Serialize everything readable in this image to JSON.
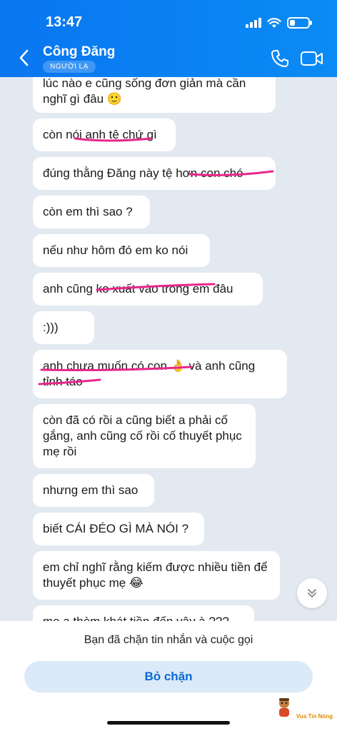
{
  "status_bar": {
    "time": "13:47"
  },
  "header": {
    "contact_name": "Công Đăng",
    "badge": "NGƯỜI LẠ"
  },
  "messages": [
    {
      "text": "lúc nào e cũng sống đơn giản mà cần nghĩ gì đâu 🙂"
    },
    {
      "text": "còn nói anh tệ chứ gì"
    },
    {
      "text": "đúng thằng Đăng này tệ hơn con chó"
    },
    {
      "text": "còn em thì sao ?"
    },
    {
      "text": "nếu như hôm đó em ko nói"
    },
    {
      "text": "anh cũng ko xuất vào trong em đâu"
    },
    {
      "text": ":)))"
    },
    {
      "text": "anh chưa muốn có con 👌 và anh cũng tỉnh táo"
    },
    {
      "text": "còn đã có rồi a cũng biết a phải cố gắng, anh cũng cố rồi cố thuyết phục mẹ rồi"
    },
    {
      "text": "nhưng em thì sao"
    },
    {
      "text": "biết CÁI ĐÉO GÌ MÀ NÓI ?"
    },
    {
      "text": "em chỉ nghĩ rằng kiếm được nhiều tiền để thuyết phục mẹ 😂"
    },
    {
      "text": "mẹ a thèm khát tiền đến vậy à ???"
    }
  ],
  "footer": {
    "blocked_notice": "Bạn đã chặn tin nhắn và cuộc gọi",
    "unblock_label": "Bỏ chặn",
    "watermark": "Vua Tin Nóng"
  },
  "icons": {
    "back": "chevron-left-icon",
    "call": "phone-icon",
    "video": "video-camera-icon",
    "scroll": "double-chevron-down-icon"
  },
  "colors": {
    "header_blue": "#0a7ff2",
    "highlight_pink": "#e8268a",
    "unblock_bg": "#dbe9f8",
    "unblock_text": "#0a68d6"
  }
}
